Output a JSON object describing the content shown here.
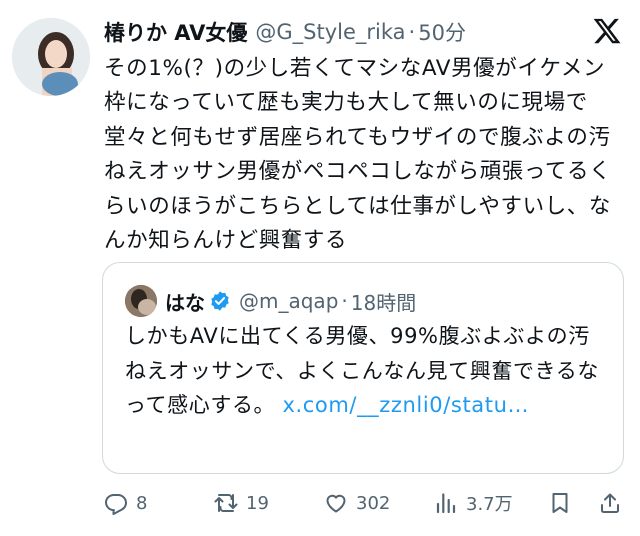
{
  "tweet": {
    "display_name": "椿りか AV女優",
    "handle": "@G_Style_rika",
    "separator": "·",
    "time": "50分",
    "text": "その1%(？)の少し若くてマシなAV男優がイケメン枠になっていて歴も実力も大して無いのに現場で堂々と何もせず居座られてもウザイので腹ぶよの汚ねえオッサン男優がペコペコしながら頑張ってるくらいのほうがこちらとしては仕事がしやすいし、なんか知らんけど興奮する"
  },
  "quote": {
    "display_name": "はな",
    "handle": "@m_aqap",
    "separator": "·",
    "time": "18時間",
    "text": "しかもAVに出てくる男優、99%腹ぶよぶよの汚ねえオッサンで、よくこんなん見て興奮できるなって感心する。",
    "link": "x.com/__zznli0/statu…"
  },
  "actions": {
    "replies": "8",
    "retweets": "19",
    "likes": "302",
    "views": "3.7万"
  },
  "icons": {
    "logo": "x-logo-icon",
    "verified": "verified-badge-icon",
    "reply": "reply-icon",
    "retweet": "retweet-icon",
    "like": "heart-icon",
    "views": "views-icon",
    "bookmark": "bookmark-icon",
    "share": "share-icon"
  },
  "colors": {
    "link": "#1d9bf0",
    "secondary_text": "#536471",
    "verified": "#1d9bf0"
  }
}
